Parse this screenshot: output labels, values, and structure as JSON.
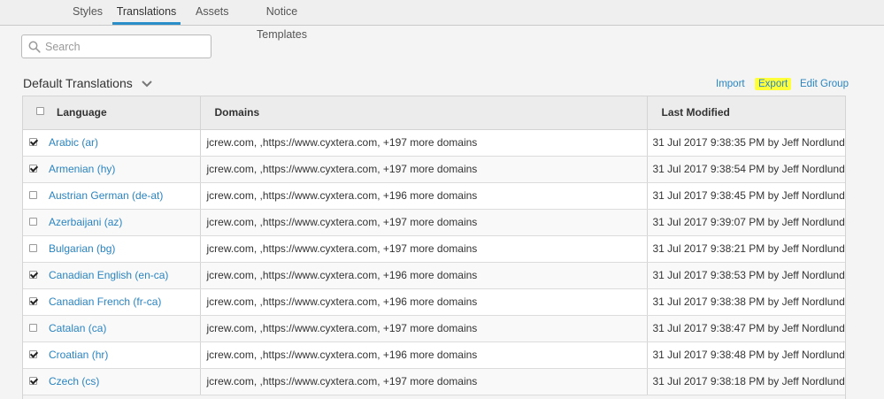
{
  "tabs": [
    {
      "label": "Styles",
      "active": false
    },
    {
      "label": "Translations",
      "active": true
    },
    {
      "label": "Assets",
      "active": false
    },
    {
      "label": "Notice Templates",
      "active": false
    }
  ],
  "search": {
    "placeholder": "Search",
    "value": "",
    "icon": "search-icon"
  },
  "group": {
    "title": "Default Translations",
    "caret_icon": "chevron-down-icon"
  },
  "actions": {
    "import": "Import",
    "export": "Export",
    "edit_group": "Edit Group"
  },
  "table": {
    "headers": {
      "language": "Language",
      "domains": "Domains",
      "last_modified": "Last Modified"
    },
    "rows": [
      {
        "checked": true,
        "language": "Arabic (ar)",
        "domains": "jcrew.com, ,https://www.cyxtera.com, +197 more domains",
        "last_modified": "31 Jul 2017 9:38:35 PM by Jeff Nordlund"
      },
      {
        "checked": true,
        "language": "Armenian (hy)",
        "domains": "jcrew.com, ,https://www.cyxtera.com, +197 more domains",
        "last_modified": "31 Jul 2017 9:38:54 PM by Jeff Nordlund"
      },
      {
        "checked": false,
        "language": "Austrian German (de-at)",
        "domains": "jcrew.com, ,https://www.cyxtera.com, +196 more domains",
        "last_modified": "31 Jul 2017 9:38:45 PM by Jeff Nordlund"
      },
      {
        "checked": false,
        "language": "Azerbaijani (az)",
        "domains": "jcrew.com, ,https://www.cyxtera.com, +197 more domains",
        "last_modified": "31 Jul 2017 9:39:07 PM by Jeff Nordlund"
      },
      {
        "checked": false,
        "language": "Bulgarian (bg)",
        "domains": "jcrew.com, ,https://www.cyxtera.com, +197 more domains",
        "last_modified": "31 Jul 2017 9:38:21 PM by Jeff Nordlund"
      },
      {
        "checked": true,
        "language": "Canadian English (en-ca)",
        "domains": "jcrew.com, ,https://www.cyxtera.com, +196 more domains",
        "last_modified": "31 Jul 2017 9:38:53 PM by Jeff Nordlund"
      },
      {
        "checked": true,
        "language": "Canadian French (fr-ca)",
        "domains": "jcrew.com, ,https://www.cyxtera.com, +196 more domains",
        "last_modified": "31 Jul 2017 9:38:38 PM by Jeff Nordlund"
      },
      {
        "checked": false,
        "language": "Catalan (ca)",
        "domains": "jcrew.com, ,https://www.cyxtera.com, +197 more domains",
        "last_modified": "31 Jul 2017 9:38:47 PM by Jeff Nordlund"
      },
      {
        "checked": true,
        "language": "Croatian (hr)",
        "domains": "jcrew.com, ,https://www.cyxtera.com, +196 more domains",
        "last_modified": "31 Jul 2017 9:38:48 PM by Jeff Nordlund"
      },
      {
        "checked": true,
        "language": "Czech (cs)",
        "domains": "jcrew.com, ,https://www.cyxtera.com, +197 more domains",
        "last_modified": "31 Jul 2017 9:38:18 PM by Jeff Nordlund"
      }
    ]
  },
  "colors": {
    "accent": "#2a8fc9",
    "link": "#2a84c0",
    "highlight": "#ffff3a"
  }
}
